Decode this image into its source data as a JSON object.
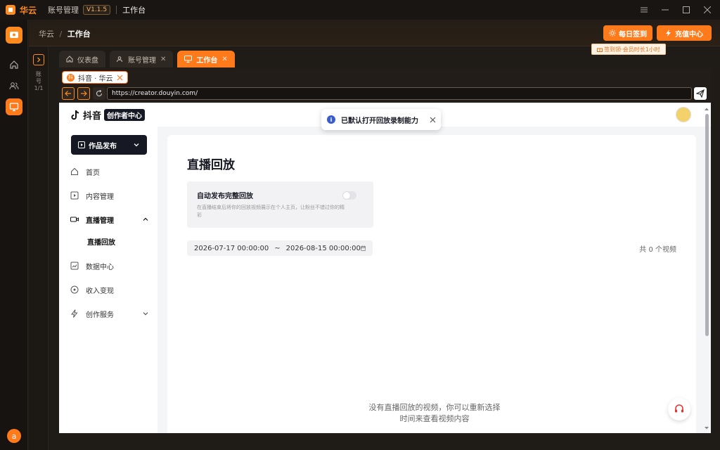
{
  "titlebar": {
    "app_name": "华云",
    "title": "账号管理",
    "version": "V1.1.5",
    "section": "工作台"
  },
  "header": {
    "breadcrumb_root": "华云",
    "breadcrumb_sep": "/",
    "breadcrumb_current": "工作台",
    "daily_checkin": "每日签到",
    "recharge": "充值中心",
    "tooltip": "签到领·会员时长1小时"
  },
  "rail": {
    "avatar_letter": "a"
  },
  "strip": {
    "label": "账号 1/1"
  },
  "tabs": [
    {
      "label": "仪表盘"
    },
    {
      "label": "账号管理"
    },
    {
      "label": "工作台"
    }
  ],
  "browser": {
    "tab_label": "抖音 · 华云",
    "url": "https://creator.douyin.com/"
  },
  "page": {
    "logo_text": "抖音",
    "logo_badge": "创作者中心",
    "publish": "作品发布",
    "menu": {
      "home": "首页",
      "content": "内容管理",
      "live": "直播管理",
      "replay": "直播回放",
      "data": "数据中心",
      "income": "收入变现",
      "service": "创作服务"
    },
    "heading": "直播回放",
    "card_title": "自动发布完整回放",
    "card_desc": "在直播结束后将你的回放视频展示在个人主页，让粉丝不错过你的精彩",
    "date_start": "2026-07-17 00:00:00",
    "date_sep": "~",
    "date_end": "2026-08-15 00:00:00",
    "count": "共 0 个视频",
    "empty_line1": "没有直播回放的视频，你可以重新选择",
    "empty_line2": "时间来查看视频内容"
  },
  "toast": {
    "text": "已默认打开回放录制能力"
  },
  "colors": {
    "accent": "#ff7a1a",
    "dark": "#161823"
  }
}
